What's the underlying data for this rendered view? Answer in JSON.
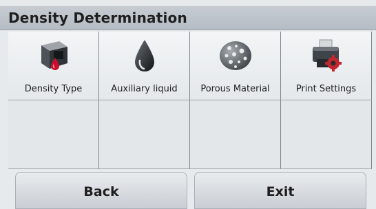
{
  "header": {
    "title": "Density Determination"
  },
  "menu": {
    "items": [
      {
        "label": "Density Type",
        "icon": "density-cube-icon"
      },
      {
        "label": "Auxiliary liquid",
        "icon": "liquid-drop-icon"
      },
      {
        "label": "Porous Material",
        "icon": "porous-rock-icon"
      },
      {
        "label": "Print Settings",
        "icon": "printer-gear-icon"
      }
    ]
  },
  "footer": {
    "back_label": "Back",
    "exit_label": "Exit"
  },
  "colors": {
    "header_bg": "#bcc3ca",
    "gear": "#c1272d",
    "drop_red": "#c8102e"
  }
}
